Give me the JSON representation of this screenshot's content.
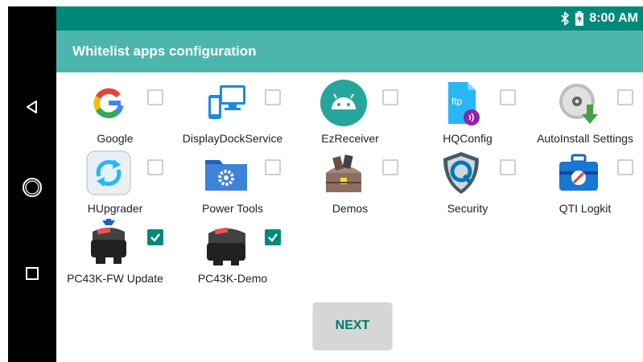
{
  "status_bar": {
    "time": "8:00 AM",
    "bluetooth_icon": "bluetooth-icon",
    "battery_icon": "battery-charging-icon"
  },
  "app_bar": {
    "title": "Whitelist apps configuration"
  },
  "nav": {
    "back_icon": "back-triangle-icon",
    "home_icon": "home-circle-icon",
    "recents_icon": "recents-square-icon"
  },
  "apps": [
    {
      "label": "Google",
      "icon": "google-icon",
      "checked": false
    },
    {
      "label": "DisplayDockService",
      "icon": "display-dock-icon",
      "checked": false
    },
    {
      "label": "EzReceiver",
      "icon": "android-icon",
      "checked": false
    },
    {
      "label": "HQConfig",
      "icon": "ftp-file-icon",
      "checked": false
    },
    {
      "label": "AutoInstall Settings",
      "icon": "disc-download-icon",
      "checked": false
    },
    {
      "label": "HUpgrader",
      "icon": "refresh-circle-icon",
      "checked": false
    },
    {
      "label": "Power Tools",
      "icon": "gear-folder-icon",
      "checked": false
    },
    {
      "label": "Demos",
      "icon": "treasure-chest-icon",
      "checked": false
    },
    {
      "label": "Security",
      "icon": "q-shield-icon",
      "checked": false
    },
    {
      "label": "QTI Logkit",
      "icon": "toolbox-icon",
      "checked": false
    },
    {
      "label": "PC43K-FW Update",
      "icon": "printer-update-icon",
      "checked": true
    },
    {
      "label": "PC43K-Demo",
      "icon": "printer-icon",
      "checked": true
    }
  ],
  "next_button": {
    "label": "NEXT"
  },
  "colors": {
    "status_bar": "#00897b",
    "app_bar": "#4db6ac",
    "accent": "#00897b",
    "nav_bar": "#000000"
  }
}
